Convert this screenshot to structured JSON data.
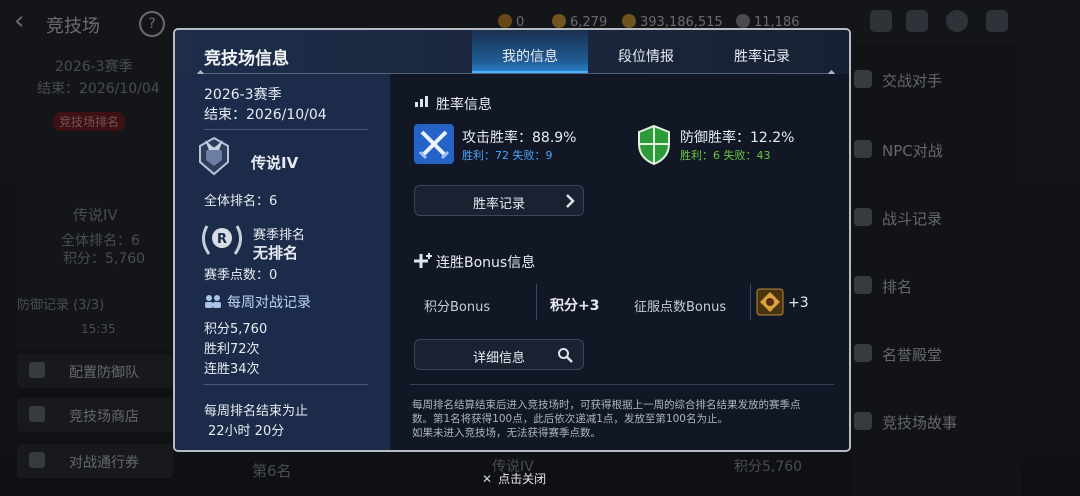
{
  "background": {
    "title": "竞技场",
    "resources": [
      {
        "value": "0"
      },
      {
        "value": "6,279"
      },
      {
        "value": "393,186,515"
      },
      {
        "value": "11,186"
      }
    ],
    "left_panel": {
      "season": "2026-3赛季",
      "end": "结束：2026/10/04",
      "badge": "竞技场排名",
      "rank_name": "传说IV",
      "overall_rank": "全体排名：6",
      "points": "积分：5,760",
      "defense_record": "防御记录 (3/3)",
      "time_range": "15:35",
      "buttons": [
        "配置防御队",
        "竞技场商店",
        "对战通行券"
      ]
    },
    "right_menu": [
      "交战对手",
      "NPC对战",
      "战斗记录",
      "排名",
      "名誉殿堂",
      "竞技场故事"
    ],
    "bottom_left": "第6名",
    "bottom_mid": "传说IV",
    "bottom_right": "积分5,760"
  },
  "modal": {
    "title": "竞技场信息",
    "tabs": [
      {
        "label": "我的信息",
        "active": true
      },
      {
        "label": "段位情报",
        "active": false
      },
      {
        "label": "胜率记录",
        "active": false
      }
    ],
    "season": "2026-3赛季",
    "season_end": "结束：2026/10/04",
    "rank_name": "传说IV",
    "overall_rank": "全体排名：6",
    "season_rank_label": "赛季排名",
    "season_rank_value": "无排名",
    "season_points": "赛季点数：0",
    "weekly_title": "每周对战记录",
    "weekly_points": "积分5,760",
    "weekly_wins": "胜利72次",
    "weekly_streak": "连胜34次",
    "weekly_end_label": "每周排名结束为止",
    "weekly_end_time": "22小时 20分",
    "winrate_title": "胜率信息",
    "attack_label": "攻击胜率：88.9%",
    "attack_record": "胜利：72 失败：9",
    "defense_label": "防御胜率：12.2%",
    "defense_record": "胜利：6 失败：43",
    "winrate_button": "胜率记录",
    "bonus_title": "连胜Bonus信息",
    "points_bonus_label": "积分Bonus",
    "points_bonus_value": "积分+3",
    "conquest_bonus_label": "征服点数Bonus",
    "conquest_bonus_value": "+3",
    "detail_button": "详细信息",
    "footnote_1": "每周排名结算结束后进入竞技场时，可获得根据上一周的综合排名结果发放的赛季点",
    "footnote_2": "数。第1名将获得100点，此后依次递减1点，发放至第100名为止。",
    "footnote_3": "如果未进入竞技场，无法获得赛季点数。",
    "colors": {
      "accent": "#49b4ff",
      "attack": "#4ea3ff",
      "defense": "#6cc644"
    }
  },
  "close_label": "点击关闭"
}
